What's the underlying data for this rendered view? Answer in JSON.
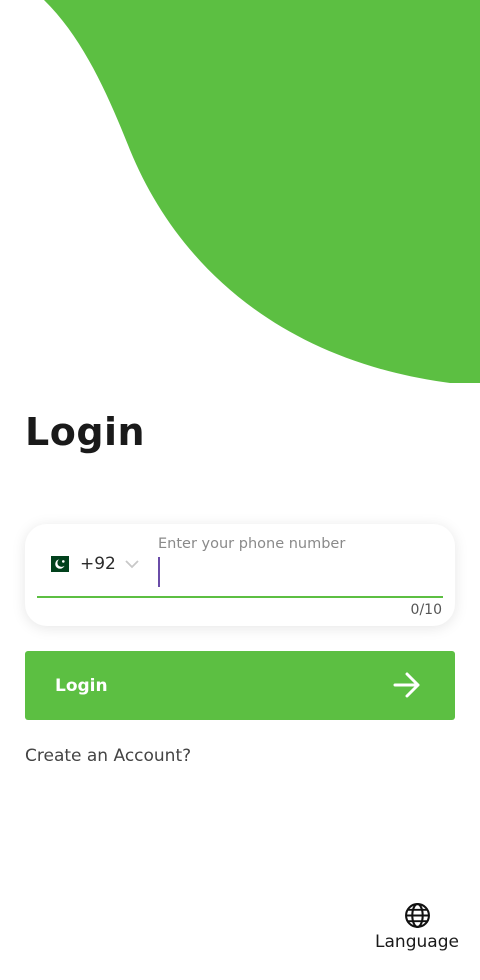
{
  "colors": {
    "brand_green": "#5cbf42",
    "caret": "#6a4ca8"
  },
  "login": {
    "title": "Login",
    "phone": {
      "country_flag_icon": "pakistan-flag-icon",
      "country_code": "+92",
      "placeholder": "Enter your phone number",
      "value": "",
      "counter": "0/10"
    },
    "button_label": "Login",
    "button_icon": "arrow-right-icon",
    "create_account": "Create an Account?"
  },
  "footer": {
    "language_icon": "globe-icon",
    "language_label": "Language"
  }
}
